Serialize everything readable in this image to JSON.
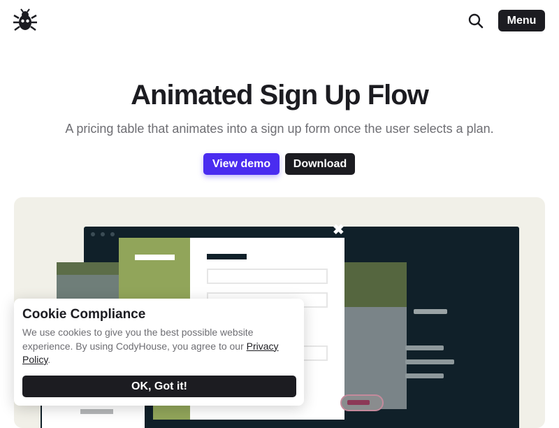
{
  "header": {
    "logo_icon": "bug-logo-icon",
    "search_icon": "search-icon",
    "menu_label": "Menu"
  },
  "hero": {
    "title": "Animated Sign Up Flow",
    "subtitle": "A pricing table that animates into a sign up form once the user selects a plan.",
    "demo_label": "View demo",
    "download_label": "Download"
  },
  "preview": {
    "close_icon": "close-icon",
    "close_glyph": "✖"
  },
  "cookie": {
    "title": "Cookie Compliance",
    "text_before_link": "We use cookies to give you the best possible website experience. By using CodyHouse, you agree to our ",
    "link_label": "Privacy Policy",
    "text_after_link": ".",
    "ok_label": "OK, Got it!"
  },
  "colors": {
    "accent": "#4a2cf0",
    "dark": "#1c1c21",
    "preview_bg": "#f1f0e8",
    "plan_green": "#91a55a"
  }
}
